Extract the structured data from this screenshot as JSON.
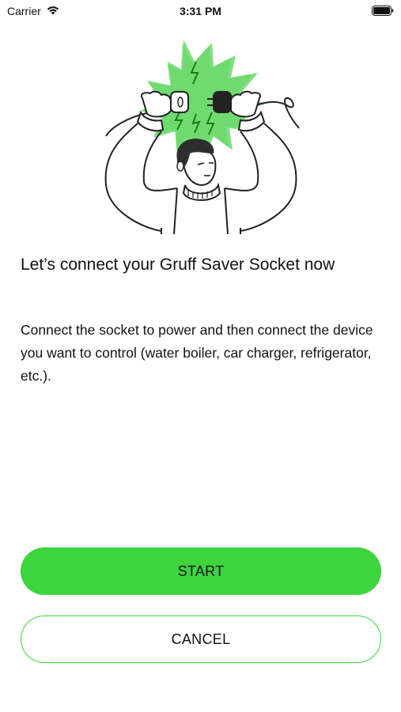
{
  "status_bar": {
    "carrier": "Carrier",
    "time": "3:31 PM",
    "wifi_icon": "wifi-icon",
    "battery_icon": "battery-icon"
  },
  "illustration": {
    "icon": "person-connecting-plug-illustration",
    "accent_color": "#3dd43d"
  },
  "onboarding": {
    "title": "Let’s connect your Gruff Saver Socket now",
    "description": "Connect the socket to power and then connect the device you want to control (water boiler, car charger, refrigerator, etc.)."
  },
  "actions": {
    "start_label": "START",
    "cancel_label": "CANCEL"
  },
  "colors": {
    "primary": "#3dd43d",
    "text": "#111111",
    "background": "#ffffff"
  }
}
